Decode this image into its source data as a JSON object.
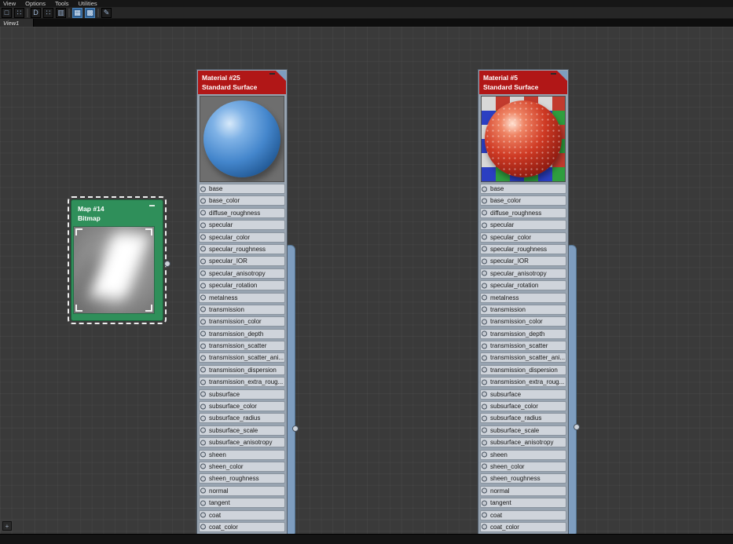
{
  "menubar": {
    "items": [
      "View",
      "Options",
      "Tools",
      "Utilities"
    ]
  },
  "toolbar": {
    "icons": [
      {
        "name": "select-tool-icon",
        "glyph": "□"
      },
      {
        "name": "region-tool-icon",
        "glyph": "∷"
      },
      {
        "sep": true
      },
      {
        "name": "material-browser-panel-icon",
        "glyph": "D"
      },
      {
        "name": "parameter-editor-panel-icon",
        "glyph": "∷"
      },
      {
        "name": "navigator-panel-icon",
        "glyph": "▥"
      },
      {
        "sep": true
      },
      {
        "name": "layout-all-icon",
        "glyph": "▦",
        "active": true
      },
      {
        "name": "layout-children-icon",
        "glyph": "▩",
        "active": true
      },
      {
        "sep": true
      },
      {
        "name": "utilities-icon",
        "glyph": "✎"
      }
    ]
  },
  "tabbar": {
    "tabs": [
      {
        "label": "View1"
      }
    ]
  },
  "canvas": {
    "bitmap_node": {
      "title": "Map #14",
      "subtitle": "Bitmap"
    },
    "material_nodes": [
      {
        "title": "Material #25",
        "subtitle": "Standard Surface",
        "preview": "blue-sphere"
      },
      {
        "title": "Material #5",
        "subtitle": "Standard Surface",
        "preview": "red-sphere-on-rgb-checker"
      }
    ],
    "params": [
      "base",
      "base_color",
      "diffuse_roughness",
      "specular",
      "specular_color",
      "specular_roughness",
      "specular_IOR",
      "specular_anisotropy",
      "specular_rotation",
      "metalness",
      "transmission",
      "transmission_color",
      "transmission_depth",
      "transmission_scatter",
      "transmission_scatter_ani...",
      "transmission_dispersion",
      "transmission_extra_roug...",
      "subsurface",
      "subsurface_color",
      "subsurface_radius",
      "subsurface_scale",
      "subsurface_anisotropy",
      "sheen",
      "sheen_color",
      "sheen_roughness",
      "normal",
      "tangent",
      "coat",
      "coat_color"
    ]
  },
  "colors": {
    "material_header_red": "#b11717",
    "bitmap_header_green": "#2f8f5a",
    "flyout_blue": "#7e9dbf",
    "param_row_bg": "#cfd4db",
    "active_tool_blue": "#2d5d8f",
    "canvas_bg": "#3a3a3a"
  }
}
